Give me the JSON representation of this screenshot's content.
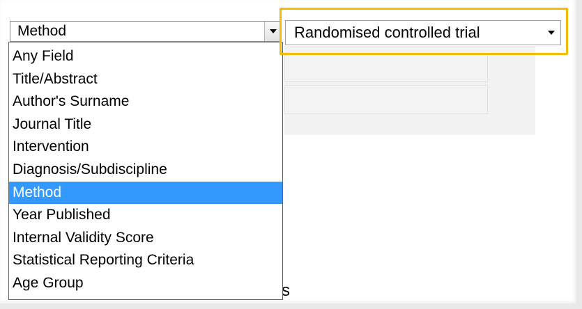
{
  "field_select": {
    "value": "Method"
  },
  "value_select": {
    "value": "Randomised controlled trial"
  },
  "dropdown": {
    "options": [
      "Any Field",
      "Title/Abstract",
      "Author's Surname",
      "Journal Title",
      "Intervention",
      "Diagnosis/Subdiscipline",
      "Method",
      "Year Published",
      "Internal Validity Score",
      "Statistical Reporting Criteria",
      "Age Group"
    ],
    "selected_index": 6
  },
  "behind_text": "s",
  "colors": {
    "highlight_outline": "#f5bb00",
    "selected_option_bg": "#3399ff"
  }
}
